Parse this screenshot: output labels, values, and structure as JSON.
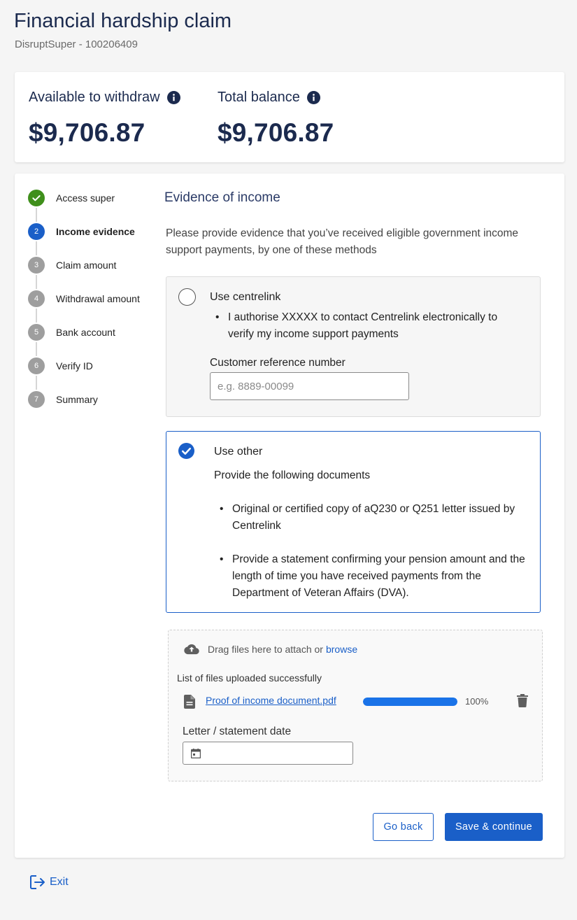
{
  "header": {
    "title": "Financial hardship claim",
    "subtitle": "DisruptSuper - 100206409"
  },
  "balances": {
    "available_label": "Available to withdraw",
    "available_value": "$9,706.87",
    "total_label": "Total balance",
    "total_value": "$9,706.87"
  },
  "stepper": {
    "steps": [
      {
        "number": "1",
        "label": "Access super",
        "state": "done"
      },
      {
        "number": "2",
        "label": "Income evidence",
        "state": "active"
      },
      {
        "number": "3",
        "label": "Claim amount",
        "state": "pending"
      },
      {
        "number": "4",
        "label": "Withdrawal amount",
        "state": "pending"
      },
      {
        "number": "5",
        "label": "Bank account",
        "state": "pending"
      },
      {
        "number": "6",
        "label": "Verify ID",
        "state": "pending"
      },
      {
        "number": "7",
        "label": "Summary",
        "state": "pending"
      }
    ]
  },
  "section": {
    "title": "Evidence of income",
    "intro": "Please provide evidence that you’ve received eligible government income support payments, by one of these methods"
  },
  "centrelink_option": {
    "title": "Use centrelink",
    "selected": false,
    "bullet": "I authorise XXXXX to contact Centrelink electronically to verify my income support payments",
    "field_label": "Customer reference number",
    "field_placeholder": "e.g. 8889-00099",
    "field_value": ""
  },
  "other_option": {
    "title": "Use other",
    "selected": true,
    "subtitle": "Provide the following documents",
    "bullets": [
      "Original or certified copy of  aQ230 or Q251 letter issued by Centrelink",
      "Provide a statement confirming your pension amount and the length of time you have received payments from the Department of Veteran Affairs (DVA)."
    ]
  },
  "upload": {
    "drag_text": "Drag files here to attach or",
    "browse_label": "browse",
    "uploaded_label": "List of files uploaded successfully",
    "files": [
      {
        "name": "Proof of income document.pdf",
        "progress": 100,
        "progress_text": "100%"
      }
    ],
    "date_label": "Letter / statement date",
    "date_value": ""
  },
  "actions": {
    "back_label": "Go back",
    "save_label": "Save & continue"
  },
  "footer": {
    "exit_label": "Exit"
  },
  "colors": {
    "primary": "#1a5fc8",
    "success": "#3f8f1b",
    "heading": "#1b2a4e",
    "pending_step": "#9e9e9e"
  },
  "icons": {
    "info": "info-icon",
    "check": "check-icon",
    "cloud_upload": "cloud-upload-icon",
    "file": "file-icon",
    "trash": "trash-icon",
    "calendar": "calendar-icon",
    "exit": "exit-icon"
  }
}
